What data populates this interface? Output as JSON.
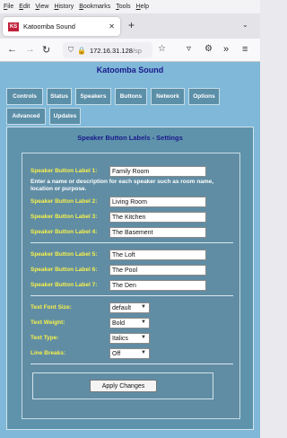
{
  "menu": {
    "items": [
      {
        "first": "F",
        "rest": "ile"
      },
      {
        "first": "E",
        "rest": "dit"
      },
      {
        "first": "V",
        "rest": "iew"
      },
      {
        "first": "H",
        "rest": "istory"
      },
      {
        "first": "B",
        "rest": "ookmarks"
      },
      {
        "first": "T",
        "rest": "ools"
      },
      {
        "first": "H",
        "rest": "elp"
      }
    ]
  },
  "browser": {
    "favicon_text": "KS",
    "tab_title": "Katoomba Sound",
    "url_main": "172.16.31.128",
    "url_faded": "/sp"
  },
  "page": {
    "title": "Katoomba Sound",
    "nav_tabs": [
      "Controls",
      "Status",
      "Speakers",
      "Buttons",
      "Network",
      "Options",
      "Advanced",
      "Updates"
    ]
  },
  "settings": {
    "title": "Speaker Button Labels - Settings",
    "help_text": "Enter a name or description for each speaker such as room name, location or purpose.",
    "labels": [
      {
        "label": "Speaker Button Label 1:",
        "value": "Family Room"
      },
      {
        "label": "Speaker Button Label 2:",
        "value": "Living Room"
      },
      {
        "label": "Speaker Button Label 3:",
        "value": "The Kitchen"
      },
      {
        "label": "Speaker Button Label 4:",
        "value": "The Basement"
      },
      {
        "label": "Speaker Button Label 5:",
        "value": "The Loft"
      },
      {
        "label": "Speaker Button Label 6:",
        "value": "The Pool"
      },
      {
        "label": "Speaker Button Label 7:",
        "value": "The Den"
      }
    ],
    "options": [
      {
        "label": "Text Font Size:",
        "value": "default"
      },
      {
        "label": "Text Weight:",
        "value": "Bold"
      },
      {
        "label": "Text Type:",
        "value": "Italics"
      },
      {
        "label": "Line Breaks:",
        "value": "Off"
      }
    ],
    "apply_label": "Apply Changes"
  },
  "colors": {
    "page_bg": "#7fb8d8",
    "panel_bg": "#5e93ab",
    "label_yellow": "#f7f04a",
    "title_blue": "#1a1a8c"
  }
}
